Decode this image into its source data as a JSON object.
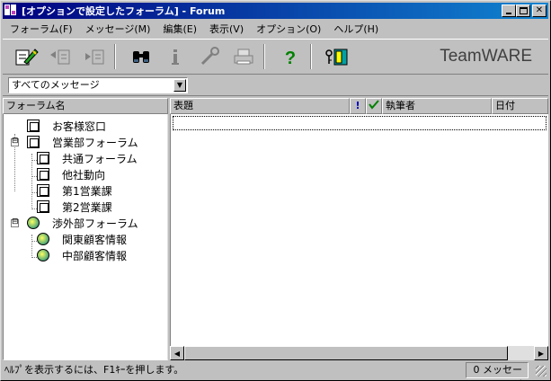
{
  "window": {
    "title": "[オプションで設定したフォーラム] - Forum"
  },
  "menu": [
    "フォーラム(F)",
    "メッセージ(M)",
    "編集(E)",
    "表示(V)",
    "オプション(O)",
    "ヘルプ(H)"
  ],
  "toolbar": {
    "brand": "TeamWARE",
    "icons": [
      "new-message-icon",
      "reply-icon",
      "forward-icon",
      "find-icon",
      "info-icon",
      "tools-icon",
      "print-icon",
      "help-icon",
      "exit-icon"
    ]
  },
  "filter": {
    "selected": "すべてのメッセージ"
  },
  "tree": {
    "header": "フォーラム名",
    "items": [
      "お客様窓口",
      "営業部フォーラム",
      "共通フォーラム",
      "他社動向",
      "第1営業課",
      "第2営業課",
      "渉外部フォーラム",
      "関東顧客情報",
      "中部顧客情報"
    ],
    "expand_symbol": "⊟"
  },
  "list": {
    "columns": {
      "subject": "表題",
      "priority": "!",
      "author": "執筆者",
      "date": "日付"
    }
  },
  "status": {
    "help_text": "ﾍﾙﾌﾟを表示するには、F1ｷｰを押します。",
    "message_count": "0 メッセージ"
  },
  "colors": {
    "titlebar_start": "#000080",
    "titlebar_end": "#1084d0",
    "face": "#c0c0c0"
  }
}
